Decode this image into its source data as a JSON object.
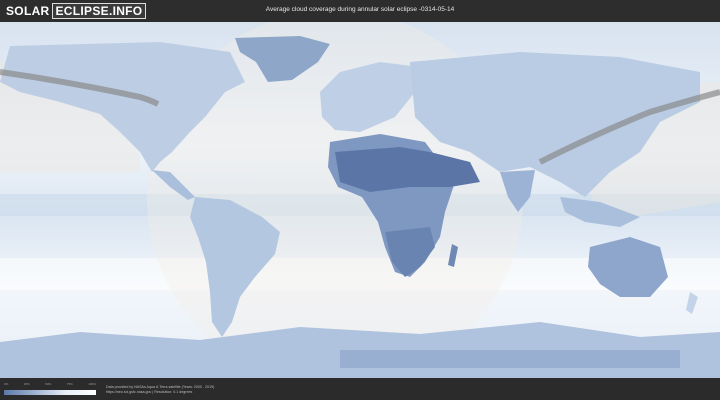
{
  "header": {
    "brand_part1": "SOLAR",
    "brand_part2": "ECLIPSE.INFO",
    "title": "Average cloud coverage during annular solar eclipse -0314-05-14"
  },
  "legend": {
    "ticks": [
      "0%",
      "25%",
      "50%",
      "75%",
      "100%"
    ],
    "gradient_colors": [
      "#5b79a8",
      "#9fb3d0",
      "#e7eef7",
      "#ffffff"
    ]
  },
  "footer": {
    "credit_line1": "Data provided by NASAs Aqua & Terra satellite (Years: 2000 - 2019)",
    "credit_line2": "https://neo.sci.gsfc.nasa.gov | Resolution: 0.1 degrees"
  },
  "colors": {
    "ocean": "#e6edf6",
    "land": "#b9cbe2",
    "dark_land": "#5b75a6",
    "eclipse_path": "#8a8a8a",
    "visibility_zone": "#efeae2"
  }
}
